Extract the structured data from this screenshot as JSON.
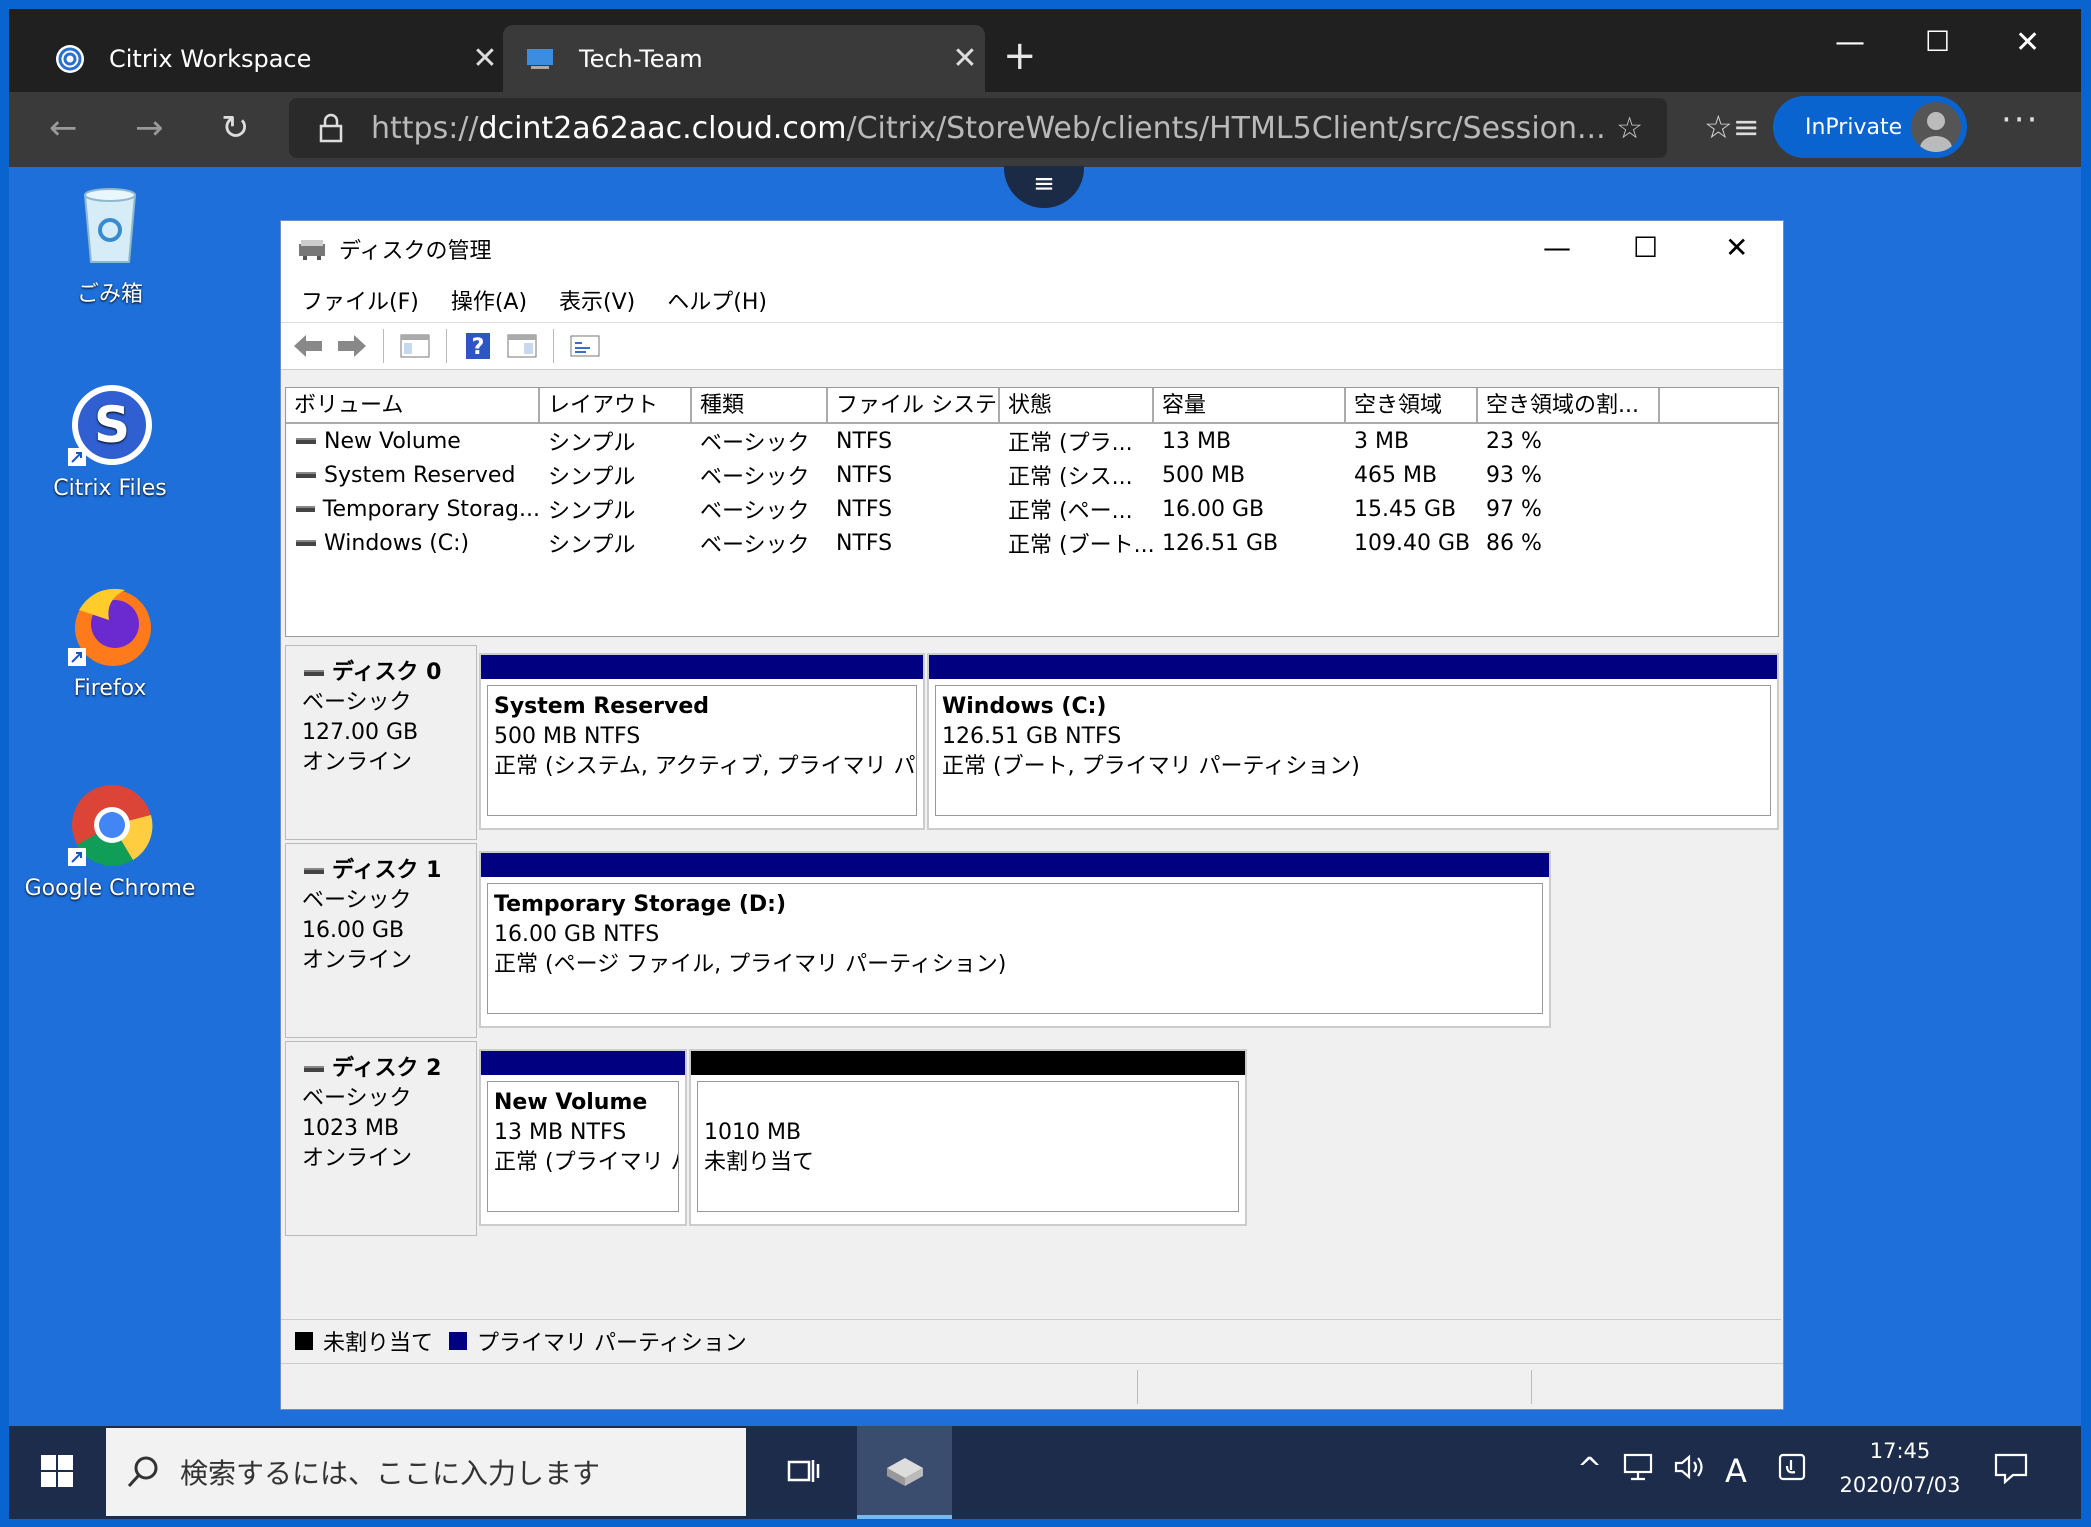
{
  "browser": {
    "tabs": [
      {
        "label": "Citrix Workspace",
        "icon": "citrix-icon"
      },
      {
        "label": "Tech-Team",
        "icon": "monitor-icon"
      }
    ],
    "url_prefix": "https://",
    "url_host": "dcint2a62aac.cloud.com",
    "url_path": "/Citrix/StoreWeb/clients/HTML5Client/src/Session...",
    "inprivate_label": "InPrivate"
  },
  "desktop": {
    "icons": [
      {
        "label": "ごみ箱",
        "icon": "recycle-bin-icon"
      },
      {
        "label": "Citrix Files",
        "icon": "citrix-files-icon"
      },
      {
        "label": "Firefox",
        "icon": "firefox-icon"
      },
      {
        "label": "Google Chrome",
        "icon": "chrome-icon"
      }
    ]
  },
  "diskmgmt": {
    "title": "ディスクの管理",
    "menu": [
      "ファイル(F)",
      "操作(A)",
      "表示(V)",
      "ヘルプ(H)"
    ],
    "columns": [
      "ボリューム",
      "レイアウト",
      "種類",
      "ファイル システム",
      "状態",
      "容量",
      "空き領域",
      "空き領域の割..."
    ],
    "volumes": [
      [
        "New Volume",
        "シンプル",
        "ベーシック",
        "NTFS",
        "正常 (プラ...",
        "13 MB",
        "3 MB",
        "23 %"
      ],
      [
        "System Reserved",
        "シンプル",
        "ベーシック",
        "NTFS",
        "正常 (シス...",
        "500 MB",
        "465 MB",
        "93 %"
      ],
      [
        "Temporary Storag...",
        "シンプル",
        "ベーシック",
        "NTFS",
        "正常 (ペー...",
        "16.00 GB",
        "15.45 GB",
        "97 %"
      ],
      [
        "Windows (C:)",
        "シンプル",
        "ベーシック",
        "NTFS",
        "正常 (ブート...",
        "126.51 GB",
        "109.40 GB",
        "86 %"
      ]
    ],
    "disks": [
      {
        "name": "ディスク 0",
        "type": "ベーシック",
        "size": "127.00 GB",
        "status": "オンライン",
        "partitions": [
          {
            "name": "System Reserved",
            "size": "500 MB NTFS",
            "status": "正常 (システム, アクティブ, プライマリ パーティシ"
          },
          {
            "name": "Windows  (C:)",
            "size": "126.51 GB NTFS",
            "status": "正常 (ブート, プライマリ パーティション)"
          }
        ]
      },
      {
        "name": "ディスク 1",
        "type": "ベーシック",
        "size": "16.00 GB",
        "status": "オンライン",
        "partitions": [
          {
            "name": "Temporary Storage  (D:)",
            "size": "16.00 GB NTFS",
            "status": "正常 (ページ ファイル, プライマリ パーティション)"
          }
        ]
      },
      {
        "name": "ディスク 2",
        "type": "ベーシック",
        "size": "1023 MB",
        "status": "オンライン",
        "partitions": [
          {
            "name": "New Volume",
            "size": "13 MB NTFS",
            "status": "正常 (プライマリ パ"
          },
          {
            "name": "",
            "size": "1010 MB",
            "status": "未割り当て"
          }
        ]
      }
    ],
    "legend": [
      {
        "label": "未割り当て",
        "color": "#000000"
      },
      {
        "label": "プライマリ パーティション",
        "color": "#000080"
      }
    ]
  },
  "taskbar": {
    "search_placeholder": "検索するには、ここに入力します",
    "ime": "A",
    "time": "17:45",
    "date": "2020/07/03"
  },
  "colors": {
    "desktop_bg": "#1e6fd9",
    "primary_partition": "#000080",
    "unallocated": "#000000",
    "accent": "#0a64d0"
  }
}
